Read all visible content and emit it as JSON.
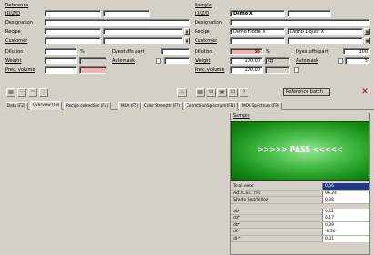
{
  "reference": {
    "title": "Reference",
    "id_label": "ID/Z/D",
    "id_value": "",
    "designation_label": "Designation",
    "designation_value": "",
    "recipe_label": "Recipe",
    "recipe_value": "",
    "customer_label": "Customer",
    "customer_value": "",
    "dilution_label": "Dilution",
    "dilution_value": "",
    "dilution_unit": "%",
    "dyestuffs_label": "Dyestuffs part",
    "dyestuffs_value": "",
    "weight_label": "Weight",
    "weight_value": "",
    "automask_label": "Automask",
    "prec_volume_label": "Prec. volume",
    "prec_volume_value": ""
  },
  "sample": {
    "title": "Sample",
    "id_label": "ID/Z/D",
    "id_value": "Demo X",
    "designation_label": "Designation",
    "designation_value": "",
    "recipe_label": "Recipe",
    "recipe_value": "Demo Flotte X",
    "recipe_value_2": "Demo Liquor X",
    "customer_label": "Customer",
    "customer_value": "",
    "dilution_label": "Dilution",
    "dilution_value": "95",
    "dilution_unit": "%",
    "dyestuffs_label": "Dyestuffs part",
    "dyestuffs_value": "100",
    "weight_label": "Weight",
    "weight_value": "100,00",
    "weight_unit": "kg",
    "automask_label": "Automask",
    "automask_value": "5",
    "prec_volume_label": "Prec. volume",
    "prec_volume_value": "100,00",
    "prec_volume_unit": "l",
    "reference_batch_label": "Reference batch"
  },
  "tabs": [
    {
      "label": "Data (F2)"
    },
    {
      "label": "Overview (F3)"
    },
    {
      "label": "Recipe correction (F4)"
    },
    {
      "label": "MCA (F5)"
    },
    {
      "label": "Color Strength (F7)"
    },
    {
      "label": "Correction Spectrum (F8)"
    },
    {
      "label": "MCA Spectrum (F9)"
    }
  ],
  "results": {
    "title": "Sample",
    "status": ">>>>> PASS <<<<<",
    "rows": [
      {
        "label": "Total error",
        "value": "0,56"
      },
      {
        "label": "Act./Calc. (%)",
        "value": "96,24"
      },
      {
        "label": "Shade Red/Yellow",
        "value": "0,38"
      },
      {
        "label": "",
        "value": ""
      },
      {
        "label": "dL*",
        "value": "0,51"
      },
      {
        "label": "da*",
        "value": "0,17"
      },
      {
        "label": "db*",
        "value": "0,39"
      },
      {
        "label": "dC*",
        "value": "-0,30"
      },
      {
        "label": "dH*",
        "value": "0,31"
      }
    ]
  },
  "icons": {
    "close": "close-icon",
    "save": "save-icon",
    "grid": "grid-icon"
  },
  "colors": {
    "pass_green": "#1fa31f",
    "highlight_blue": "#1f3a8a",
    "dilution_pink": "#f4b0b0"
  }
}
